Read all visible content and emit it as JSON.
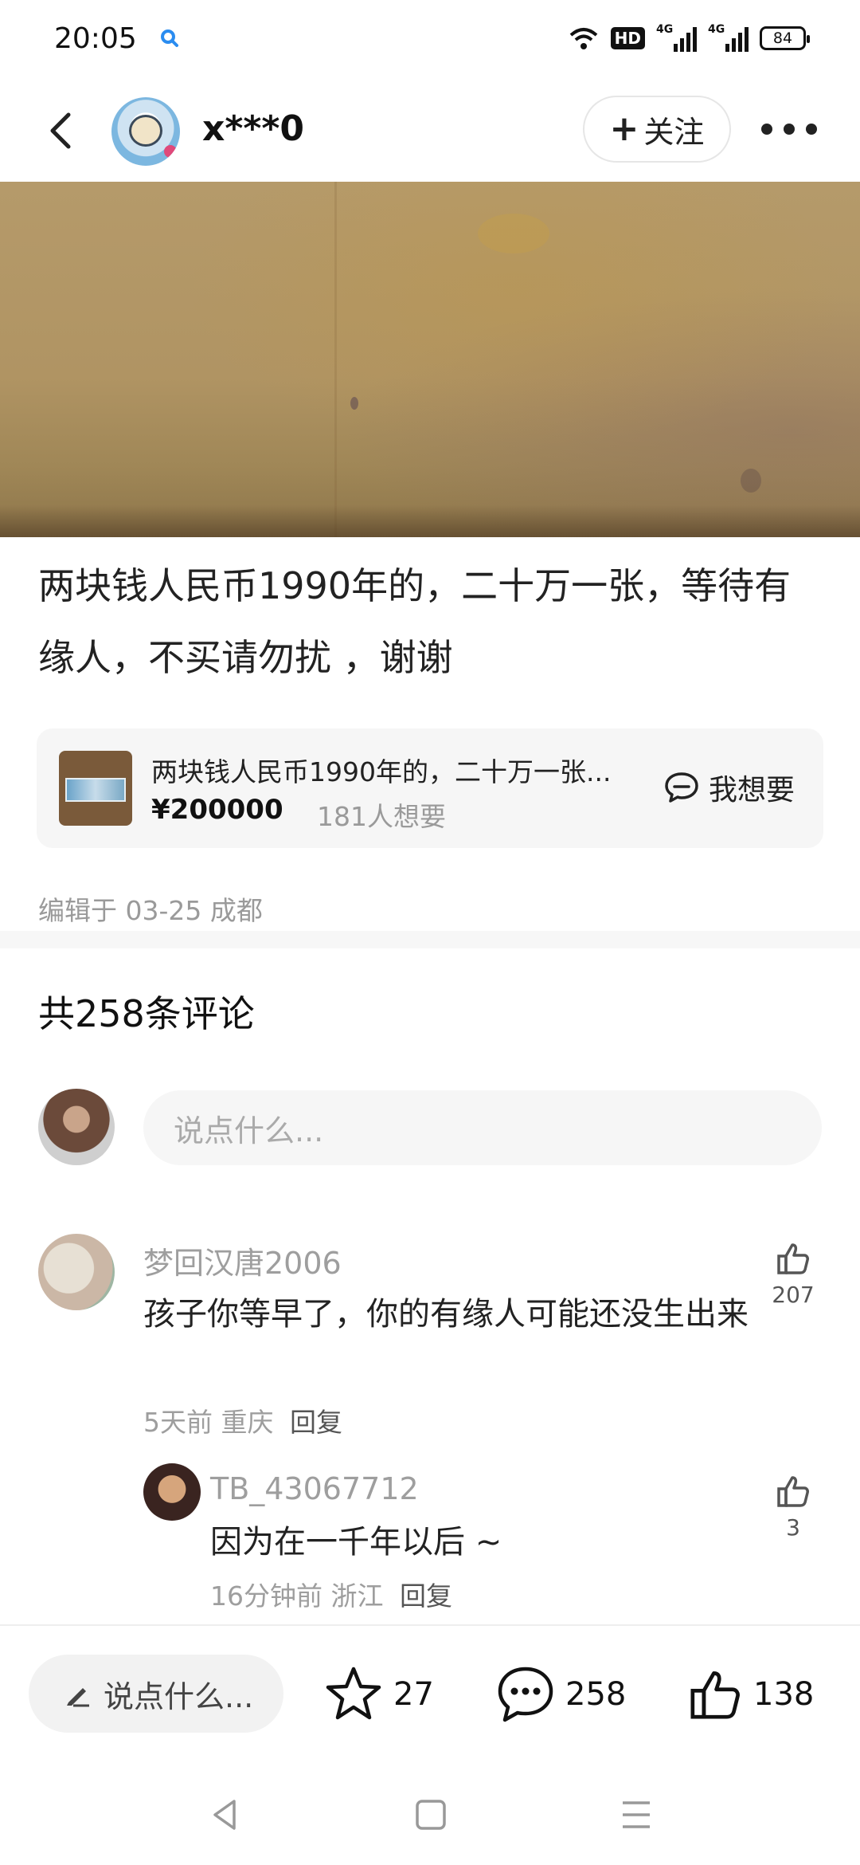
{
  "status_bar": {
    "time": "20:05",
    "hd": "HD",
    "net1": "4G",
    "net2": "4G",
    "battery": "84"
  },
  "header": {
    "username": "x***0",
    "follow_label": "关注",
    "follow_plus": "+"
  },
  "post": {
    "text": "两块钱人民币1990年的，二十万一张，等待有缘人，不买请勿扰 ，谢谢",
    "edit_meta": "编辑于 03-25 成都"
  },
  "product": {
    "title": "两块钱人民币1990年的，二十万一张...",
    "price": "¥200000",
    "wants": "181人想要",
    "want_button": "我想要"
  },
  "comments": {
    "title": "共258条评论",
    "input_placeholder": "说点什么...",
    "items": [
      {
        "name": "梦回汉唐2006",
        "text": "孩子你等早了，你的有缘人可能还没生出来",
        "time": "5天前",
        "location": "重庆",
        "reply_label": "回复",
        "likes": "207"
      },
      {
        "name": "TB_43067712",
        "text": "因为在一千年以后 ~",
        "time": "16分钟前",
        "location": "浙江",
        "reply_label": "回复",
        "likes": "3"
      }
    ]
  },
  "bottom_bar": {
    "input_label": "说点什么...",
    "favorites": "27",
    "comments": "258",
    "likes": "138"
  },
  "icons": {
    "back": "back-arrow-icon",
    "more": "more-dots-icon",
    "chat": "chat-bubble-icon",
    "like": "thumbs-up-icon",
    "star": "star-icon",
    "pen": "pen-icon"
  },
  "colors": {
    "text": "#111111",
    "muted": "#9e9e9e",
    "card_bg": "#f6f6f6",
    "accent_search": "#2a8cf0"
  }
}
